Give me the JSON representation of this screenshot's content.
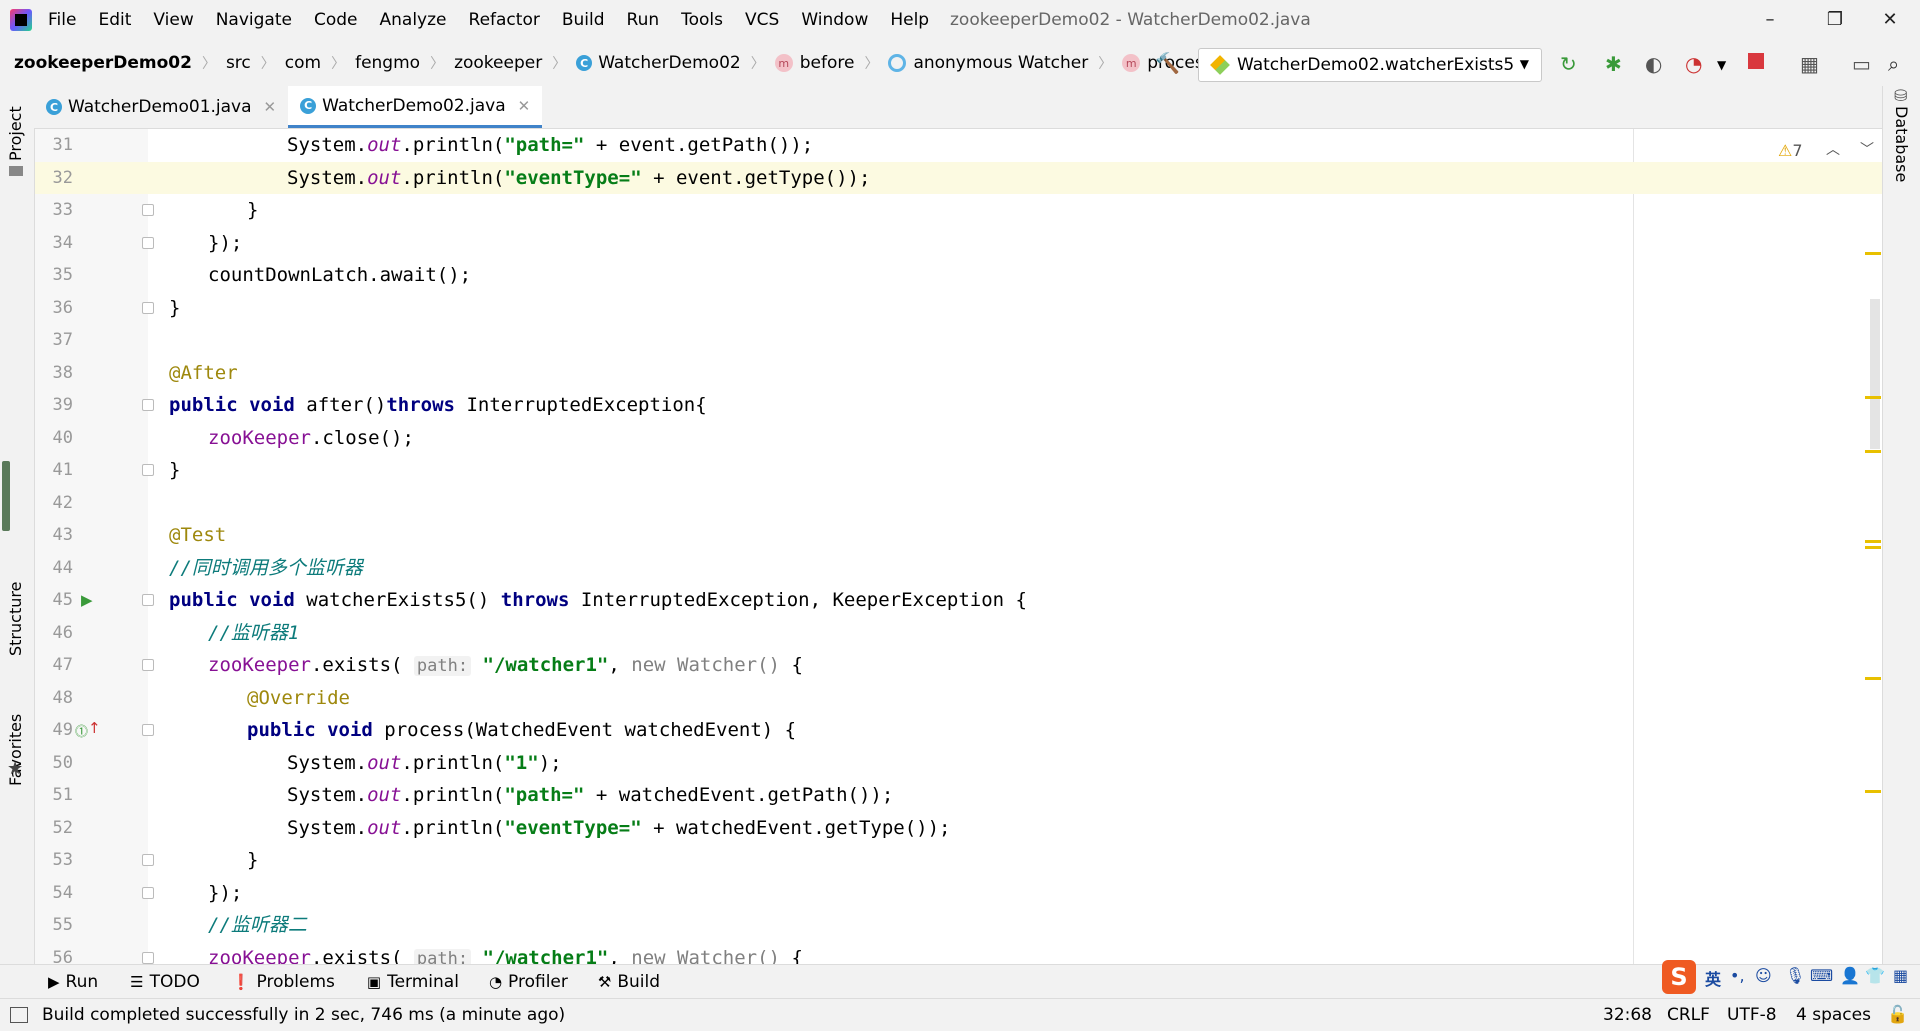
{
  "titlebar": {
    "menu": [
      "File",
      "Edit",
      "View",
      "Navigate",
      "Code",
      "Analyze",
      "Refactor",
      "Build",
      "Run",
      "Tools",
      "VCS",
      "Window",
      "Help"
    ],
    "window_title": "zookeeperDemo02 - WatcherDemo02.java"
  },
  "breadcrumb": {
    "project": "zookeeperDemo02",
    "items": [
      "src",
      "com",
      "fengmo",
      "zookeeper",
      "WatcherDemo02",
      "before",
      "anonymous Watcher",
      "process"
    ]
  },
  "run_config": {
    "label": "WatcherDemo02.watcherExists5"
  },
  "tabs": [
    {
      "label": "WatcherDemo01.java"
    },
    {
      "label": "WatcherDemo02.java"
    }
  ],
  "side_panels": {
    "project": "Project",
    "structure": "Structure",
    "favorites": "Favorites",
    "database": "Database"
  },
  "editor": {
    "warning_count": "7",
    "line_numbers": [
      "31",
      "32",
      "33",
      "34",
      "35",
      "36",
      "37",
      "38",
      "39",
      "40",
      "41",
      "42",
      "43",
      "44",
      "45",
      "46",
      "47",
      "48",
      "49",
      "50",
      "51",
      "52",
      "53",
      "54",
      "55",
      "56"
    ],
    "param_hint": "path:"
  },
  "bottom_tools": [
    "Run",
    "TODO",
    "Problems",
    "Terminal",
    "Profiler",
    "Build"
  ],
  "status": {
    "message": "Build completed successfully in 2 sec, 746 ms (a minute ago)",
    "position": "32:68",
    "line_sep": "CRLF",
    "encoding": "UTF-8",
    "indent": "4 spaces"
  },
  "ime": {
    "lang": "英"
  },
  "colors": {
    "keyword": "#000080",
    "string": "#067d17",
    "field": "#871094",
    "annotation": "#9e880d",
    "highlight_line": "#fcfae1",
    "tab_underline": "#4083c9"
  }
}
